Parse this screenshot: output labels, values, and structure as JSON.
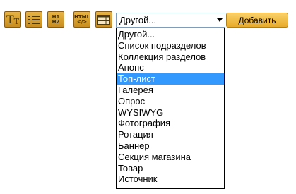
{
  "toolbar": {
    "buttons": [
      {
        "icon": "text-format-icon"
      },
      {
        "icon": "list-icon"
      },
      {
        "icon": "headings-icon",
        "label_top": "H1",
        "label_bottom": "H2"
      },
      {
        "icon": "html-code-icon",
        "label_top": "HTML",
        "label_bottom": "</>"
      },
      {
        "icon": "table-icon"
      }
    ]
  },
  "block_type_select": {
    "value": "Другой..."
  },
  "add_button": {
    "label": "Добавить"
  },
  "dropdown": {
    "selected_index": 4,
    "options": [
      "Другой...",
      "Список подразделов",
      "Коллекция разделов",
      "Анонс",
      "Топ-лист",
      "Галерея",
      "Опрос",
      "WYSIWYG",
      "Фотография",
      "Ротация",
      "Баннер",
      "Секция магазина",
      "Товар",
      "Источник"
    ]
  }
}
